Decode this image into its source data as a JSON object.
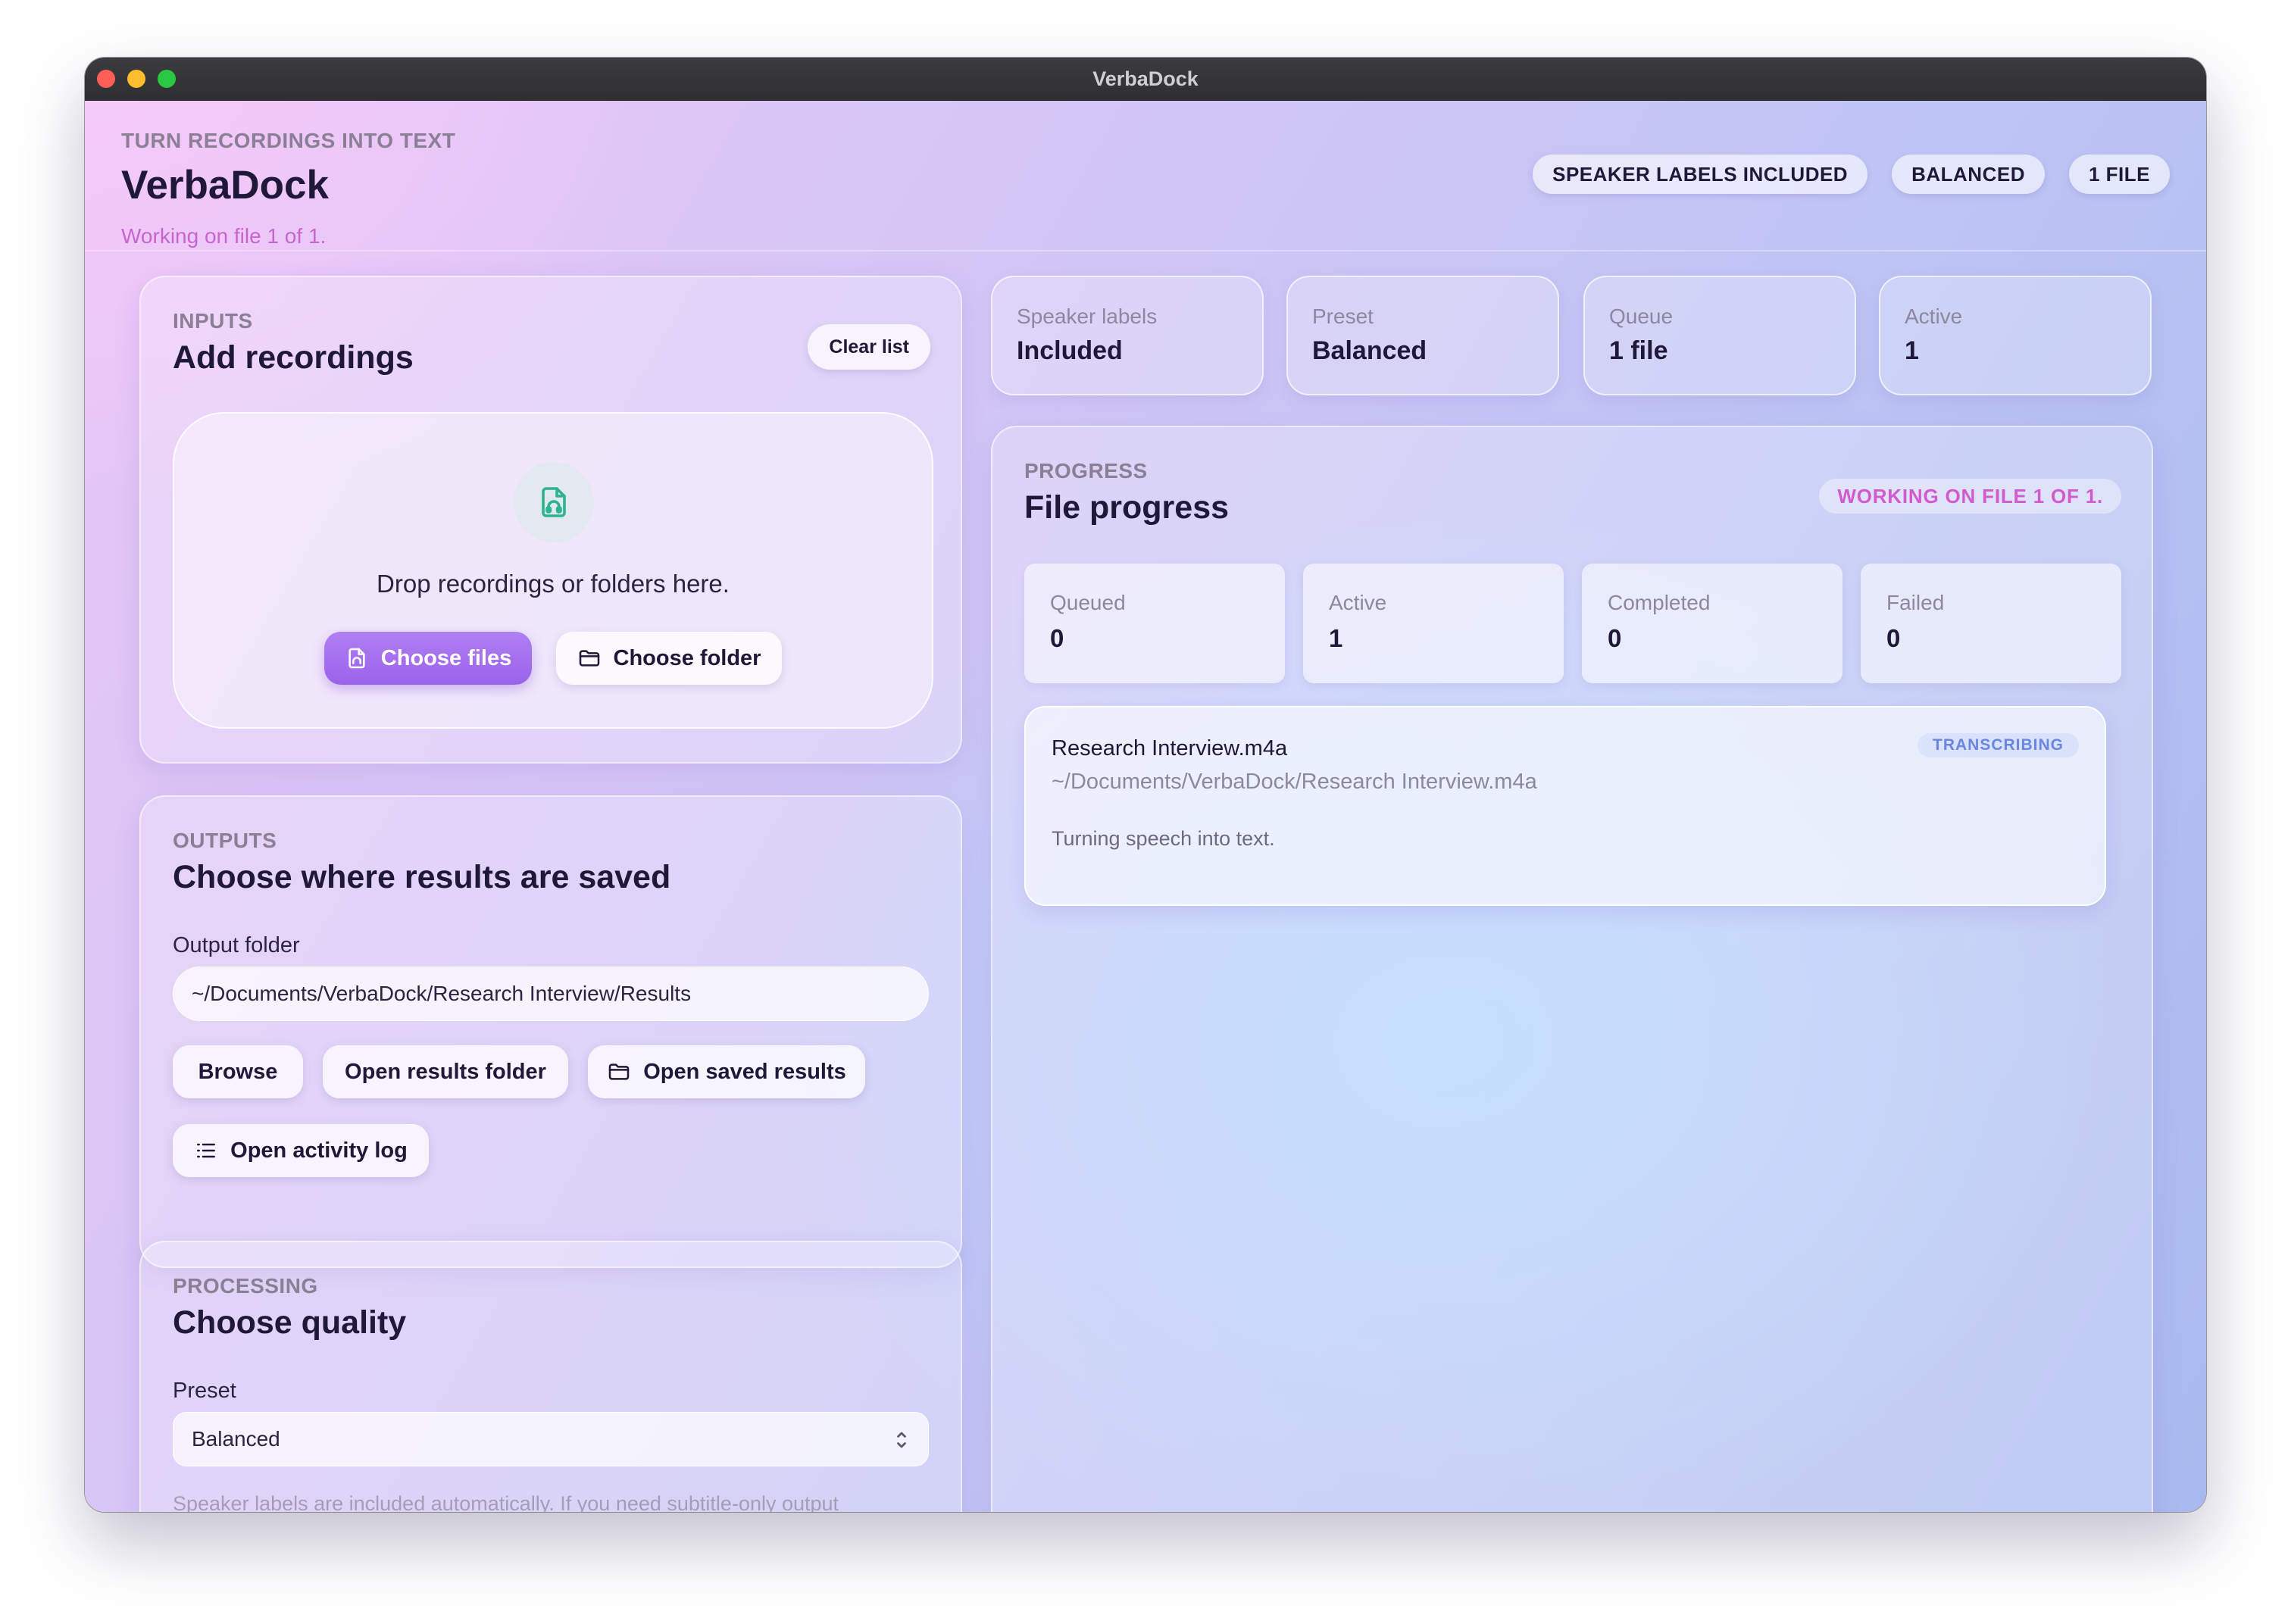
{
  "window": {
    "title": "VerbaDock"
  },
  "header": {
    "eyebrow": "TURN RECORDINGS INTO TEXT",
    "title": "VerbaDock",
    "status": "Working on file 1 of 1.",
    "pills": [
      "SPEAKER LABELS INCLUDED",
      "BALANCED",
      "1 FILE"
    ]
  },
  "inputs": {
    "eyebrow": "INPUTS",
    "title": "Add recordings",
    "clear_label": "Clear list",
    "drop_text": "Drop recordings or folders here.",
    "choose_files_label": "Choose files",
    "choose_folder_label": "Choose folder"
  },
  "outputs": {
    "eyebrow": "OUTPUTS",
    "title": "Choose where results are saved",
    "folder_label": "Output folder",
    "folder_value": "~/Documents/VerbaDock/Research Interview/Results",
    "browse_label": "Browse",
    "open_results_label": "Open results folder",
    "open_saved_label": "Open saved results",
    "open_log_label": "Open activity log"
  },
  "processing": {
    "eyebrow": "PROCESSING",
    "title": "Choose quality",
    "preset_label": "Preset",
    "preset_value": "Balanced",
    "help": "Speaker labels are included automatically. If you need subtitle-only output"
  },
  "summary": [
    {
      "label": "Speaker labels",
      "value": "Included"
    },
    {
      "label": "Preset",
      "value": "Balanced"
    },
    {
      "label": "Queue",
      "value": "1 file"
    },
    {
      "label": "Active",
      "value": "1"
    }
  ],
  "progress": {
    "eyebrow": "PROGRESS",
    "title": "File progress",
    "badge": "WORKING ON FILE 1 OF 1.",
    "counts": [
      {
        "label": "Queued",
        "value": "0"
      },
      {
        "label": "Active",
        "value": "1"
      },
      {
        "label": "Completed",
        "value": "0"
      },
      {
        "label": "Failed",
        "value": "0"
      }
    ],
    "file": {
      "name": "Research Interview.m4a",
      "path": "~/Documents/VerbaDock/Research Interview.m4a",
      "status": "TRANSCRIBING",
      "message": "Turning speech into text."
    }
  },
  "colors": {
    "accent": "#9a62ea",
    "status_pink": "#c765cf",
    "transcribing_blue": "#6a86df"
  },
  "icons": {
    "file_audio": "file-audio-icon",
    "folder": "folder-icon",
    "list": "list-icon",
    "select_arrows": "chevron-updown-icon"
  }
}
